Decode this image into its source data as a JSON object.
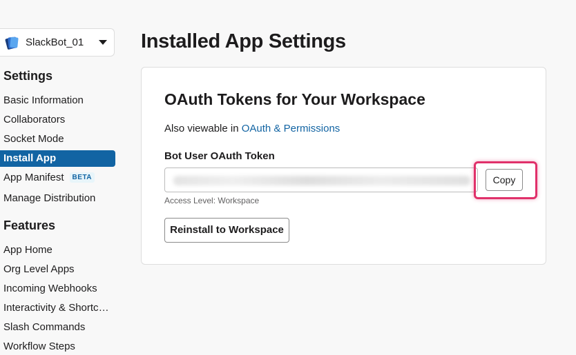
{
  "sidebar": {
    "app_switcher": {
      "app_name": "SlackBot_01",
      "icon": "stacked-cards-icon"
    },
    "settings": {
      "title": "Settings",
      "items": [
        {
          "label": "Basic Information"
        },
        {
          "label": "Collaborators"
        },
        {
          "label": "Socket Mode"
        },
        {
          "label": "Install App",
          "active": true
        },
        {
          "label": "App Manifest",
          "badge": "BETA"
        },
        {
          "label": "Manage Distribution"
        }
      ]
    },
    "features": {
      "title": "Features",
      "items": [
        {
          "label": "App Home"
        },
        {
          "label": "Org Level Apps"
        },
        {
          "label": "Incoming Webhooks"
        },
        {
          "label": "Interactivity & Shortcuts"
        },
        {
          "label": "Slash Commands"
        },
        {
          "label": "Workflow Steps"
        }
      ]
    }
  },
  "main": {
    "page_title": "Installed App Settings",
    "card": {
      "title": "OAuth Tokens for Your Workspace",
      "also_viewable_prefix": "Also viewable in",
      "also_viewable_link": "OAuth & Permissions",
      "token_label": "Bot User OAuth Token",
      "token_value": "",
      "copy_button": "Copy",
      "access_level": "Access Level: Workspace",
      "reinstall_button": "Reinstall to Workspace"
    }
  },
  "colors": {
    "accent": "#1264a3",
    "highlight": "#e0306a",
    "background": "#f8f8f8"
  }
}
